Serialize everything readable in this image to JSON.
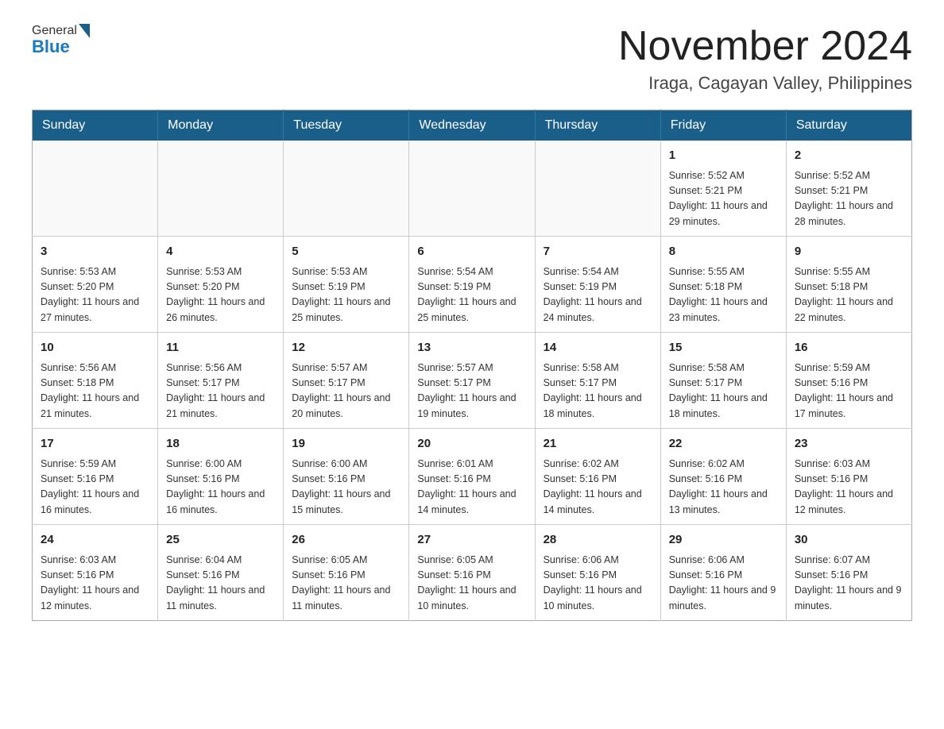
{
  "header": {
    "logo_general": "General",
    "logo_blue": "Blue",
    "title": "November 2024",
    "subtitle": "Iraga, Cagayan Valley, Philippines"
  },
  "weekdays": [
    "Sunday",
    "Monday",
    "Tuesday",
    "Wednesday",
    "Thursday",
    "Friday",
    "Saturday"
  ],
  "weeks": [
    [
      {
        "day": "",
        "info": ""
      },
      {
        "day": "",
        "info": ""
      },
      {
        "day": "",
        "info": ""
      },
      {
        "day": "",
        "info": ""
      },
      {
        "day": "",
        "info": ""
      },
      {
        "day": "1",
        "info": "Sunrise: 5:52 AM\nSunset: 5:21 PM\nDaylight: 11 hours and 29 minutes."
      },
      {
        "day": "2",
        "info": "Sunrise: 5:52 AM\nSunset: 5:21 PM\nDaylight: 11 hours and 28 minutes."
      }
    ],
    [
      {
        "day": "3",
        "info": "Sunrise: 5:53 AM\nSunset: 5:20 PM\nDaylight: 11 hours and 27 minutes."
      },
      {
        "day": "4",
        "info": "Sunrise: 5:53 AM\nSunset: 5:20 PM\nDaylight: 11 hours and 26 minutes."
      },
      {
        "day": "5",
        "info": "Sunrise: 5:53 AM\nSunset: 5:19 PM\nDaylight: 11 hours and 25 minutes."
      },
      {
        "day": "6",
        "info": "Sunrise: 5:54 AM\nSunset: 5:19 PM\nDaylight: 11 hours and 25 minutes."
      },
      {
        "day": "7",
        "info": "Sunrise: 5:54 AM\nSunset: 5:19 PM\nDaylight: 11 hours and 24 minutes."
      },
      {
        "day": "8",
        "info": "Sunrise: 5:55 AM\nSunset: 5:18 PM\nDaylight: 11 hours and 23 minutes."
      },
      {
        "day": "9",
        "info": "Sunrise: 5:55 AM\nSunset: 5:18 PM\nDaylight: 11 hours and 22 minutes."
      }
    ],
    [
      {
        "day": "10",
        "info": "Sunrise: 5:56 AM\nSunset: 5:18 PM\nDaylight: 11 hours and 21 minutes."
      },
      {
        "day": "11",
        "info": "Sunrise: 5:56 AM\nSunset: 5:17 PM\nDaylight: 11 hours and 21 minutes."
      },
      {
        "day": "12",
        "info": "Sunrise: 5:57 AM\nSunset: 5:17 PM\nDaylight: 11 hours and 20 minutes."
      },
      {
        "day": "13",
        "info": "Sunrise: 5:57 AM\nSunset: 5:17 PM\nDaylight: 11 hours and 19 minutes."
      },
      {
        "day": "14",
        "info": "Sunrise: 5:58 AM\nSunset: 5:17 PM\nDaylight: 11 hours and 18 minutes."
      },
      {
        "day": "15",
        "info": "Sunrise: 5:58 AM\nSunset: 5:17 PM\nDaylight: 11 hours and 18 minutes."
      },
      {
        "day": "16",
        "info": "Sunrise: 5:59 AM\nSunset: 5:16 PM\nDaylight: 11 hours and 17 minutes."
      }
    ],
    [
      {
        "day": "17",
        "info": "Sunrise: 5:59 AM\nSunset: 5:16 PM\nDaylight: 11 hours and 16 minutes."
      },
      {
        "day": "18",
        "info": "Sunrise: 6:00 AM\nSunset: 5:16 PM\nDaylight: 11 hours and 16 minutes."
      },
      {
        "day": "19",
        "info": "Sunrise: 6:00 AM\nSunset: 5:16 PM\nDaylight: 11 hours and 15 minutes."
      },
      {
        "day": "20",
        "info": "Sunrise: 6:01 AM\nSunset: 5:16 PM\nDaylight: 11 hours and 14 minutes."
      },
      {
        "day": "21",
        "info": "Sunrise: 6:02 AM\nSunset: 5:16 PM\nDaylight: 11 hours and 14 minutes."
      },
      {
        "day": "22",
        "info": "Sunrise: 6:02 AM\nSunset: 5:16 PM\nDaylight: 11 hours and 13 minutes."
      },
      {
        "day": "23",
        "info": "Sunrise: 6:03 AM\nSunset: 5:16 PM\nDaylight: 11 hours and 12 minutes."
      }
    ],
    [
      {
        "day": "24",
        "info": "Sunrise: 6:03 AM\nSunset: 5:16 PM\nDaylight: 11 hours and 12 minutes."
      },
      {
        "day": "25",
        "info": "Sunrise: 6:04 AM\nSunset: 5:16 PM\nDaylight: 11 hours and 11 minutes."
      },
      {
        "day": "26",
        "info": "Sunrise: 6:05 AM\nSunset: 5:16 PM\nDaylight: 11 hours and 11 minutes."
      },
      {
        "day": "27",
        "info": "Sunrise: 6:05 AM\nSunset: 5:16 PM\nDaylight: 11 hours and 10 minutes."
      },
      {
        "day": "28",
        "info": "Sunrise: 6:06 AM\nSunset: 5:16 PM\nDaylight: 11 hours and 10 minutes."
      },
      {
        "day": "29",
        "info": "Sunrise: 6:06 AM\nSunset: 5:16 PM\nDaylight: 11 hours and 9 minutes."
      },
      {
        "day": "30",
        "info": "Sunrise: 6:07 AM\nSunset: 5:16 PM\nDaylight: 11 hours and 9 minutes."
      }
    ]
  ]
}
